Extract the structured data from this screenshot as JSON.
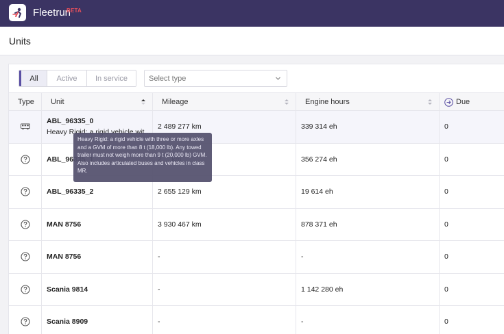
{
  "app": {
    "name": "Fleetrun",
    "badge": "BETA"
  },
  "page": {
    "title": "Units"
  },
  "filters": {
    "tabs": [
      {
        "label": "All",
        "active": true
      },
      {
        "label": "Active",
        "active": false
      },
      {
        "label": "In service",
        "active": false
      }
    ],
    "type_select": {
      "placeholder": "Select type"
    }
  },
  "table": {
    "headers": {
      "type": "Type",
      "unit": "Unit",
      "mileage": "Mileage",
      "engine_hours": "Engine hours",
      "due": "Due"
    },
    "rows": [
      {
        "type_icon": "bus-icon",
        "unit": "ABL_96335_0",
        "subtitle": "Heavy Rigid: a rigid vehicle wit...",
        "mileage": "2 489 277 km",
        "engine_hours": "339 314 eh",
        "due": "0"
      },
      {
        "type_icon": "question-circle-icon",
        "unit": "ABL_96335_1",
        "mileage": "2 ... km",
        "engine_hours": "356 274 eh",
        "due": "0"
      },
      {
        "type_icon": "question-circle-icon",
        "unit": "ABL_96335_2",
        "mileage": "2 655 129 km",
        "engine_hours": "19 614 eh",
        "due": "0"
      },
      {
        "type_icon": "question-circle-icon",
        "unit": "MAN 8756",
        "mileage": "3 930 467 km",
        "engine_hours": "878 371 eh",
        "due": "0"
      },
      {
        "type_icon": "question-circle-icon",
        "unit": "MAN 8756",
        "mileage": "-",
        "engine_hours": "-",
        "due": "0"
      },
      {
        "type_icon": "question-circle-icon",
        "unit": "Scania 9814",
        "mileage": "-",
        "engine_hours": "1 142 280 eh",
        "due": "0"
      },
      {
        "type_icon": "question-circle-icon",
        "unit": "Scania 8909",
        "mileage": "-",
        "engine_hours": "-",
        "due": "0"
      }
    ]
  },
  "tooltip": {
    "text": "Heavy Rigid: a rigid vehicle with three or more axles and a GVM of more than 8 t (18,000 lb). Any towed trailer must not weigh more than 9 t (20,000 lb) GVM. Also includes articulated buses and vehicles in class MR."
  },
  "colors": {
    "topbar": "#3b3463",
    "accent": "#5a4fa3",
    "beta": "#e8505b"
  }
}
